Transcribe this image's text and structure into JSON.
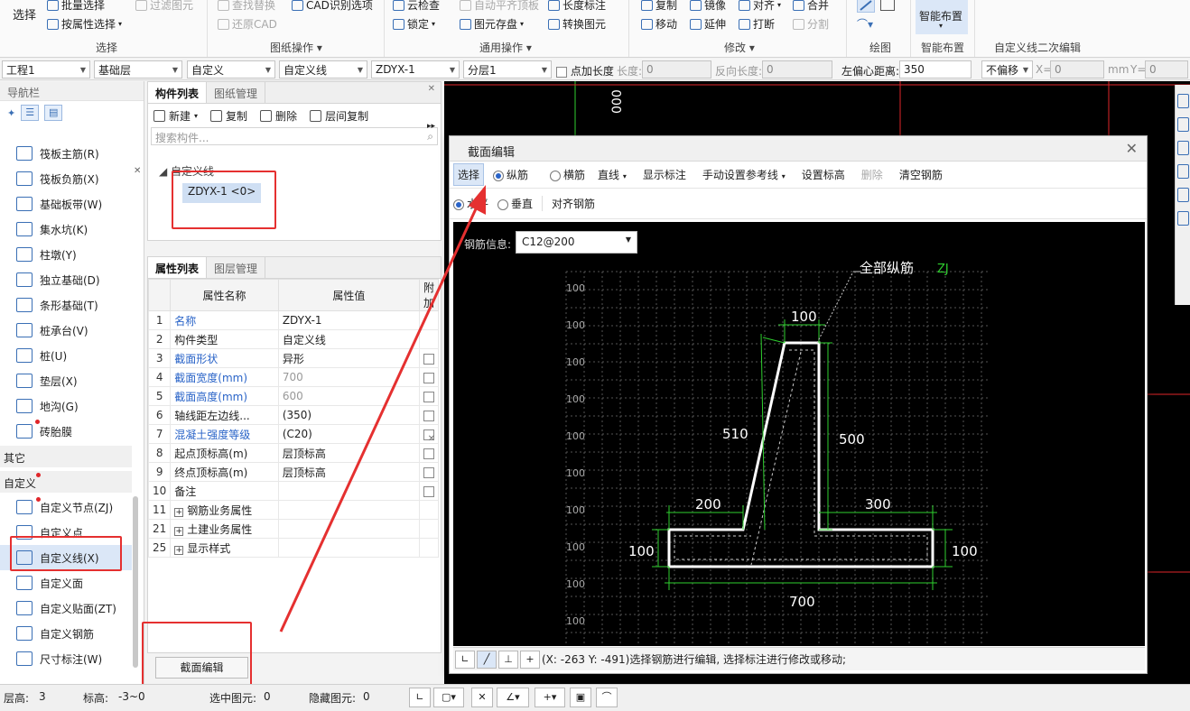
{
  "ribbon": {
    "select_label": "选择",
    "batch_select": "批量选择",
    "by_property_select": "按属性选择",
    "filter_elements": "过滤图元",
    "find_replace": "查找替换",
    "restore_cad": "还原CAD",
    "cad_identify_options": "CAD识别选项",
    "cloud_check": "云检查",
    "auto_flat_slab": "自动平齐顶板",
    "length_annotation": "长度标注",
    "lock": "锁定",
    "element_save": "图元存盘",
    "convert_element": "转换图元",
    "copy": "复制",
    "mirror": "镜像",
    "align": "对齐",
    "merge": "合并",
    "move": "移动",
    "extend": "延伸",
    "break": "打断",
    "split": "分割",
    "smart_layout": "智能布置",
    "groups": {
      "select": "选择",
      "drawing_ops": "图纸操作",
      "common_ops": "通用操作",
      "modify": "修改",
      "draw": "绘图",
      "smart_layout": "智能布置",
      "custom_line_edit": "自定义线二次编辑"
    }
  },
  "toolbar": {
    "project": "工程1",
    "layer": "基础层",
    "category": "自定义",
    "type": "自定义线",
    "component": "ZDYX-1",
    "sublayer": "分层1",
    "point_length": "点加长度",
    "length_label": "长度:",
    "length_value": "0",
    "reverse_length_label": "反向长度:",
    "reverse_length_value": "0",
    "left_offset_label": "左偏心距离:",
    "left_offset_value": "350",
    "offset_mode": "不偏移",
    "x_label": "X=",
    "x_value": "0",
    "mm_label": "mm",
    "y_label": "Y=",
    "y_value": "0"
  },
  "nav": {
    "title": "导航栏",
    "items": [
      {
        "label": "筏板主筋(R)"
      },
      {
        "label": "筏板负筋(X)"
      },
      {
        "label": "基础板带(W)"
      },
      {
        "label": "集水坑(K)"
      },
      {
        "label": "柱墩(Y)"
      },
      {
        "label": "独立基础(D)"
      },
      {
        "label": "条形基础(T)"
      },
      {
        "label": "桩承台(V)"
      },
      {
        "label": "桩(U)"
      },
      {
        "label": "垫层(X)"
      },
      {
        "label": "地沟(G)"
      },
      {
        "label": "砖胎膜"
      }
    ],
    "section_other": "其它",
    "section_custom": "自定义",
    "custom_items": [
      {
        "label": "自定义节点(ZJ)"
      },
      {
        "label": "自定义点"
      },
      {
        "label": "自定义线(X)"
      },
      {
        "label": "自定义面"
      },
      {
        "label": "自定义贴面(ZT)"
      },
      {
        "label": "自定义钢筋"
      },
      {
        "label": "尺寸标注(W)"
      }
    ]
  },
  "components": {
    "tab_list": "构件列表",
    "tab_drawing": "图纸管理",
    "new": "新建",
    "copy": "复制",
    "delete": "删除",
    "floor_copy": "层间复制",
    "search_placeholder": "搜索构件...",
    "tree_root": "自定义线",
    "tree_item": "ZDYX-1 <0>"
  },
  "properties": {
    "tab_props": "属性列表",
    "tab_layers": "图层管理",
    "col_name": "属性名称",
    "col_value": "属性值",
    "col_extra": "附加",
    "rows": [
      {
        "num": "1",
        "name": "名称",
        "value": "ZDYX-1"
      },
      {
        "num": "2",
        "name": "构件类型",
        "value": "自定义线"
      },
      {
        "num": "3",
        "name": "截面形状",
        "value": "异形"
      },
      {
        "num": "4",
        "name": "截面宽度(mm)",
        "value": "700"
      },
      {
        "num": "5",
        "name": "截面高度(mm)",
        "value": "600"
      },
      {
        "num": "6",
        "name": "轴线距左边线...",
        "value": "(350)"
      },
      {
        "num": "7",
        "name": "混凝土强度等级",
        "value": "(C20)"
      },
      {
        "num": "8",
        "name": "起点顶标高(m)",
        "value": "层顶标高"
      },
      {
        "num": "9",
        "name": "终点顶标高(m)",
        "value": "层顶标高"
      },
      {
        "num": "10",
        "name": "备注",
        "value": ""
      },
      {
        "num": "11",
        "name": "钢筋业务属性",
        "value": ""
      },
      {
        "num": "21",
        "name": "土建业务属性",
        "value": ""
      },
      {
        "num": "25",
        "name": "显示样式",
        "value": ""
      }
    ],
    "edit_button": "截面编辑"
  },
  "canvas": {
    "vertical_label": "000"
  },
  "dialog": {
    "title": "截面编辑",
    "select": "选择",
    "longitudinal": "纵筋",
    "transverse": "横筋",
    "line": "直线",
    "show_annotation": "显示标注",
    "manual_ref_line": "手动设置参考线",
    "set_elevation": "设置标高",
    "delete": "删除",
    "clear_rebar": "清空钢筋",
    "horizontal": "水平",
    "vertical": "垂直",
    "align_rebar": "对齐钢筋",
    "rebar_info_label": "钢筋信息:",
    "rebar_info_value": "C12@200",
    "all_longitudinal": "全部纵筋",
    "zj_tag": "ZJ",
    "grid_label": "100",
    "dims": {
      "top": "100",
      "slope": "510",
      "right_vertical": "500",
      "left_step": "200",
      "right_step": "300",
      "left_height": "100",
      "right_height": "100",
      "total_width": "700"
    },
    "status_text": "(X: -263 Y: -491)选择钢筋进行编辑, 选择标注进行修改或移动;"
  },
  "statusbar": {
    "floor_height_label": "层高:",
    "floor_height_value": "3",
    "elevation_label": "标高:",
    "elevation_value": "-3~0",
    "selected_label": "选中图元:",
    "selected_value": "0",
    "hidden_label": "隐藏图元:",
    "hidden_value": "0"
  },
  "colors": {
    "accent": "#3a6fb5",
    "annotation_red": "#e53030",
    "dim_green": "#2fd02f",
    "canvas_bg": "#000000"
  }
}
